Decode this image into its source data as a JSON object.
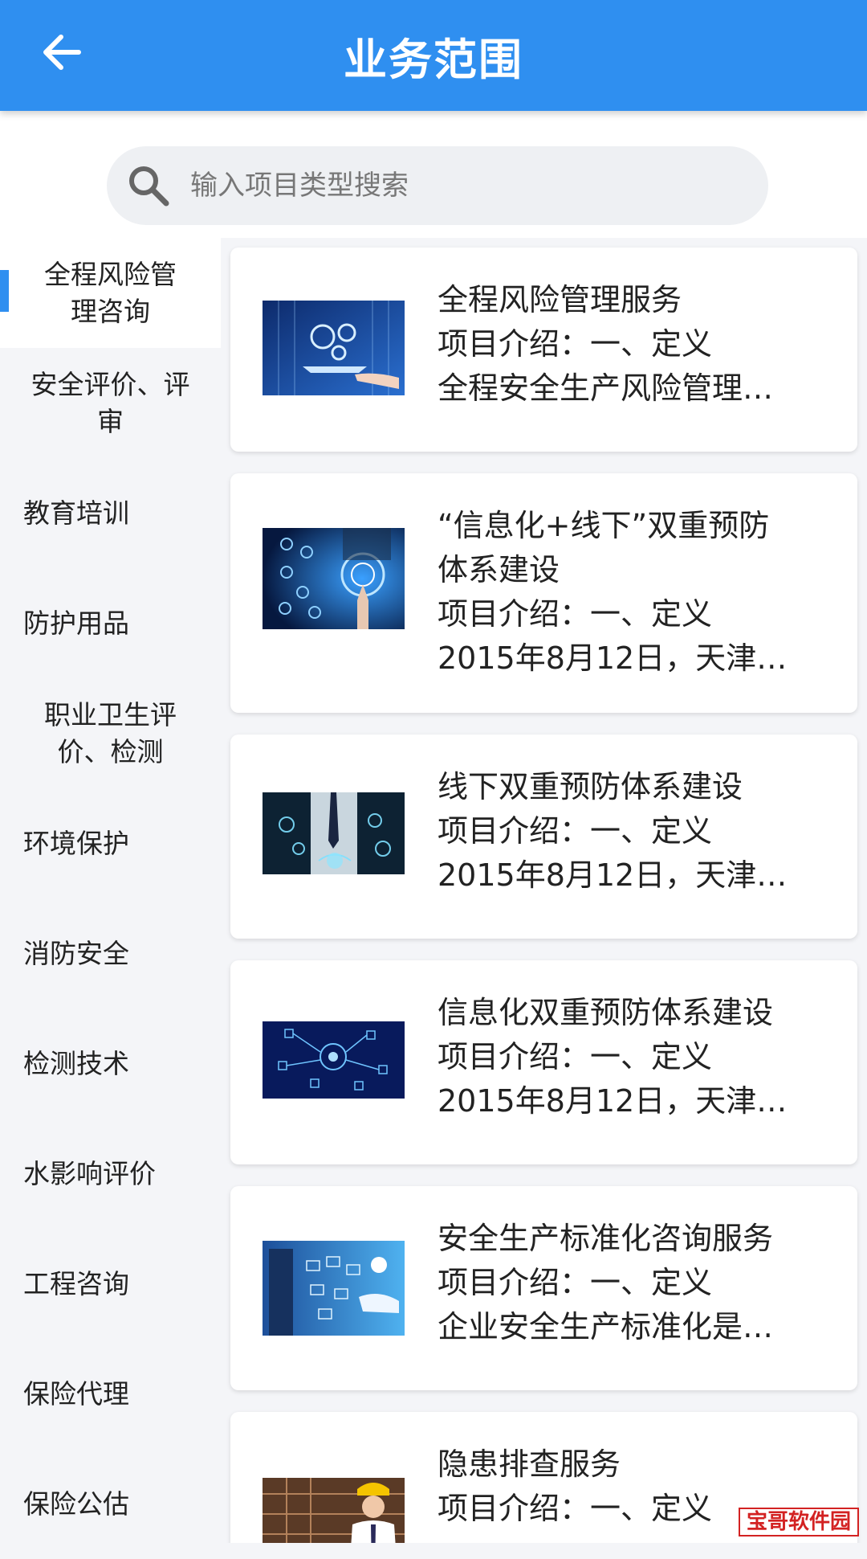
{
  "header": {
    "title": "业务范围",
    "back_icon": "arrow-left-icon"
  },
  "search": {
    "placeholder": "输入项目类型搜索",
    "value": "",
    "icon": "search-icon"
  },
  "colors": {
    "primary": "#2f8ff0",
    "background": "#f4f5f8",
    "card": "#ffffff"
  },
  "sidebar": {
    "items": [
      {
        "label": "全程风险管理咨询",
        "active": true
      },
      {
        "label": "安全评价、评审"
      },
      {
        "label": "教育培训"
      },
      {
        "label": "防护用品"
      },
      {
        "label": "职业卫生评价、检测"
      },
      {
        "label": "环境保护"
      },
      {
        "label": "消防安全"
      },
      {
        "label": "检测技术"
      },
      {
        "label": "水影响评价"
      },
      {
        "label": "工程咨询"
      },
      {
        "label": "保险代理"
      },
      {
        "label": "保险公估"
      }
    ]
  },
  "cards": [
    {
      "title": "全程风险管理服务",
      "intro": "项目介绍：一、定义",
      "summary": "全程安全生产风险管理…"
    },
    {
      "title": "“信息化+线下”双重预防体系建设",
      "title_line1": "“信息化+线下”双重预防",
      "title_line2": "体系建设",
      "intro": "项目介绍：一、定义",
      "summary": "2015年8月12日，天津…"
    },
    {
      "title": "线下双重预防体系建设",
      "intro": "项目介绍：一、定义",
      "summary": "2015年8月12日，天津…"
    },
    {
      "title": "信息化双重预防体系建设",
      "intro": "项目介绍：一、定义",
      "summary": "2015年8月12日，天津…"
    },
    {
      "title": "安全生产标准化咨询服务",
      "intro": "项目介绍：一、定义",
      "summary": "企业安全生产标准化是…"
    },
    {
      "title": "隐患排查服务",
      "intro": "项目介绍：一、定义",
      "summary": ""
    }
  ],
  "watermark": {
    "text": "宝哥软件园"
  }
}
